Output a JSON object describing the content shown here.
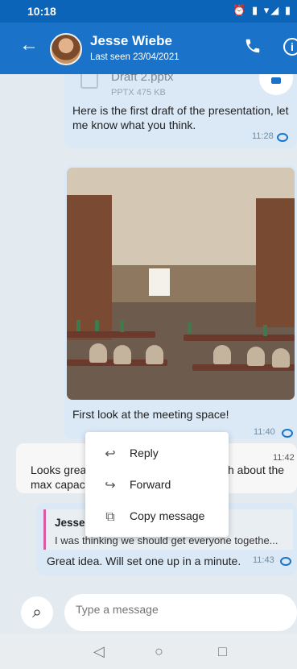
{
  "status": {
    "time": "10:18",
    "icons": "⏰ ▮ ▾◢ ▮"
  },
  "header": {
    "back": "←",
    "name": "Jesse Wiebe",
    "last_seen": "Last seen 23/04/2021",
    "info": "i"
  },
  "messages": [
    {
      "file_name": "Draft 2.pptx",
      "file_meta": "PPTX  475 KB",
      "text": "Here is the first draft of the presentation, let me know what you think.",
      "time": "11:28"
    },
    {
      "caption": "First look at the meeting space!",
      "time": "11:40"
    },
    {
      "text_left": "Looks grea",
      "text_right": "h about the",
      "text_left2": "max capac",
      "time": "11:42"
    },
    {
      "quote_name": "Jesse",
      "quote_text": "I was thinking we should get everyone togethe...",
      "text": "Great idea. Will set one up in a minute.",
      "time": "11:43"
    }
  ],
  "context_menu": [
    {
      "icon": "reply-icon",
      "label": "Reply"
    },
    {
      "icon": "forward-icon",
      "label": "Forward"
    },
    {
      "icon": "copy-icon",
      "label": "Copy message"
    }
  ],
  "composer": {
    "placeholder": "Type a message"
  }
}
